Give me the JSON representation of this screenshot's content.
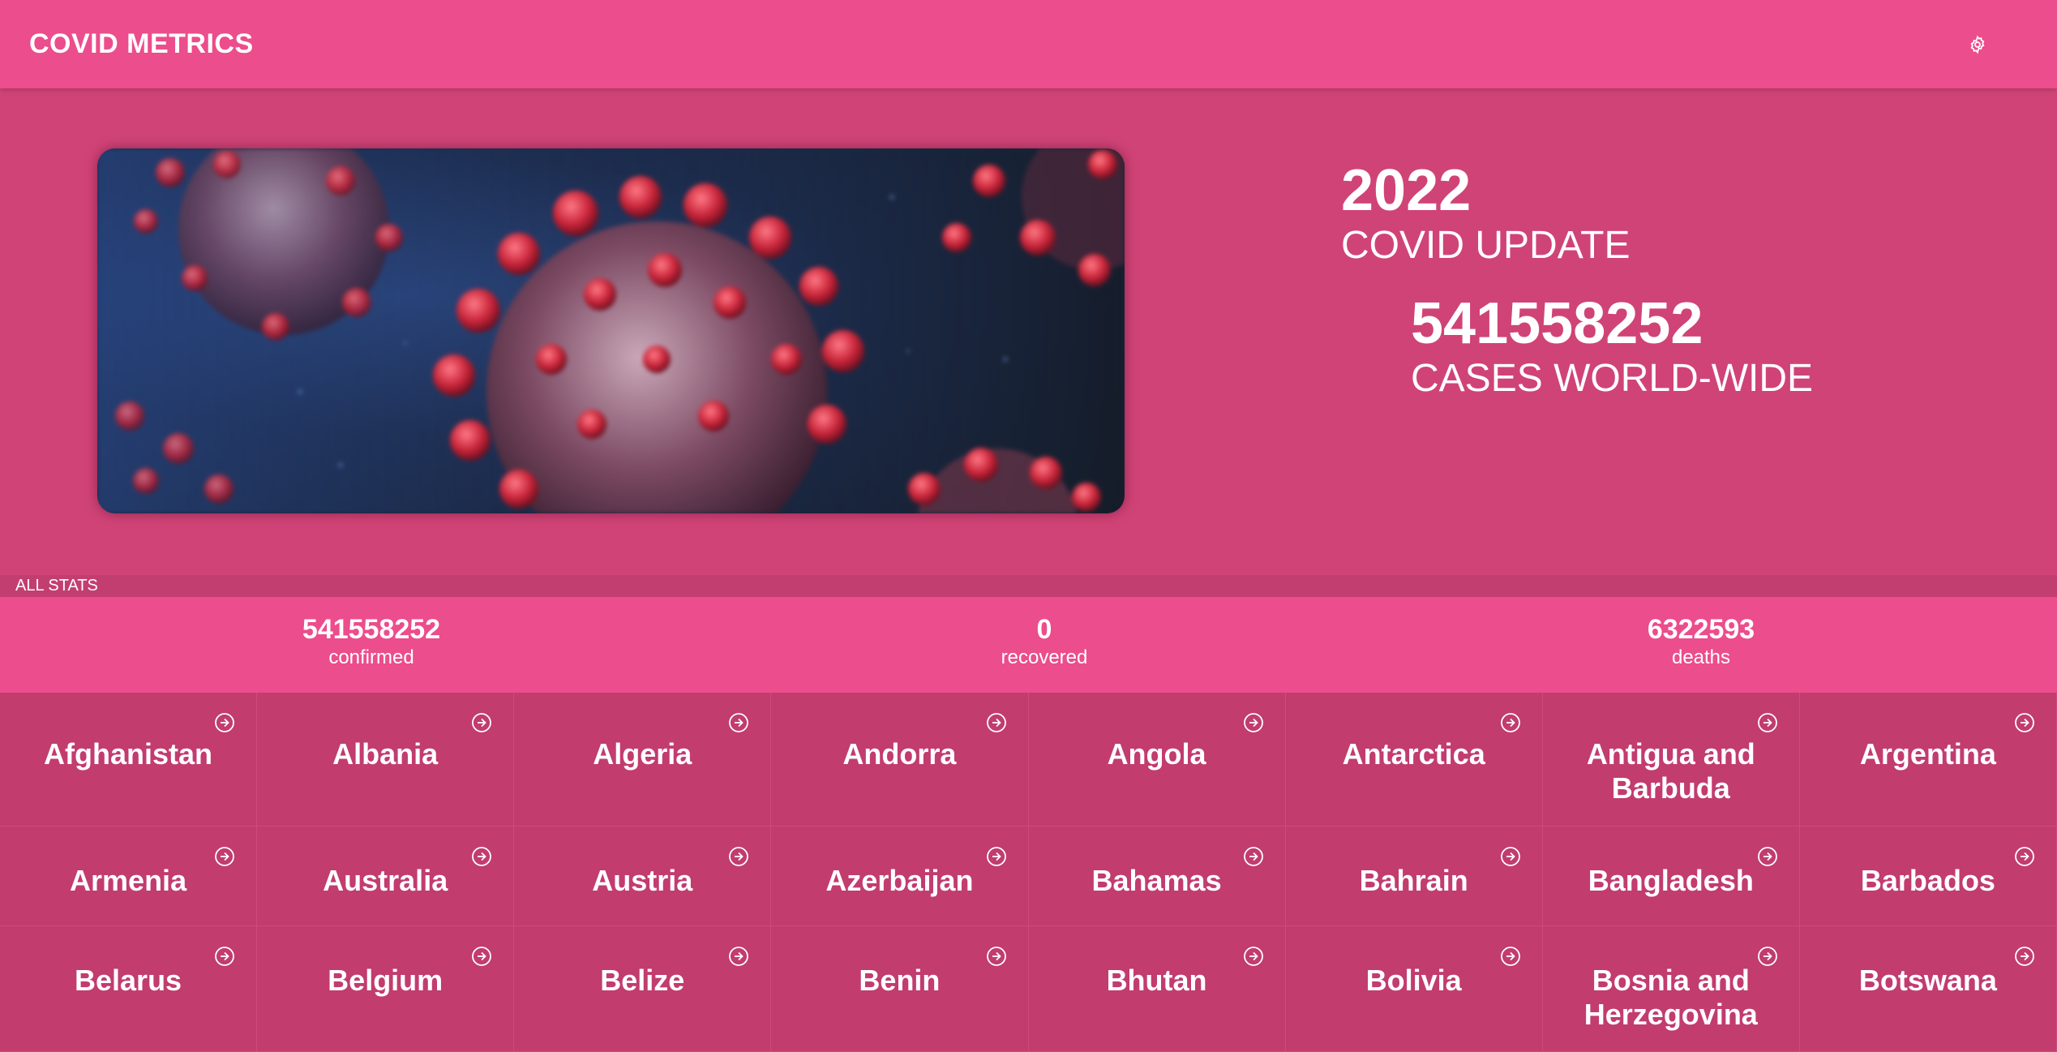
{
  "header": {
    "title": "COVID METRICS",
    "settings_icon": "gear-icon"
  },
  "hero": {
    "year": "2022",
    "update_label": "COVID UPDATE",
    "cases": "541558252",
    "cases_label": "CASES WORLD-WIDE"
  },
  "all_stats_label": "ALL STATS",
  "summary": {
    "confirmed": {
      "value": "541558252",
      "label": "confirmed"
    },
    "recovered": {
      "value": "0",
      "label": "recovered"
    },
    "deaths": {
      "value": "6322593",
      "label": "deaths"
    }
  },
  "countries": [
    "Afghanistan",
    "Albania",
    "Algeria",
    "Andorra",
    "Angola",
    "Antarctica",
    "Antigua and Barbuda",
    "Argentina",
    "Armenia",
    "Australia",
    "Austria",
    "Azerbaijan",
    "Bahamas",
    "Bahrain",
    "Bangladesh",
    "Barbados",
    "Belarus",
    "Belgium",
    "Belize",
    "Benin",
    "Bhutan",
    "Bolivia",
    "Bosnia and Herzegovina",
    "Botswana"
  ],
  "colors": {
    "header": "#ec4d8c",
    "background": "#d04376",
    "card": "#c23c6e"
  }
}
